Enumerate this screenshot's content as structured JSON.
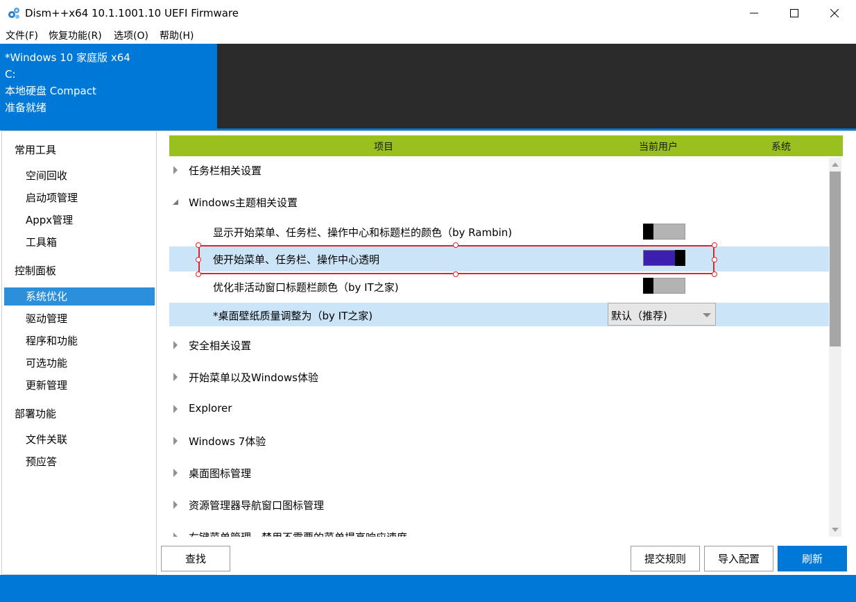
{
  "window": {
    "title": "Dism++x64 10.1.1001.10 UEFI Firmware",
    "icon": "gear-cluster-icon"
  },
  "menu": [
    "文件(F)",
    "恢复功能(R)",
    "选项(O)",
    "帮助(H)"
  ],
  "image_info": {
    "name": "*Windows 10 家庭版 x64",
    "drive": "C:",
    "disk": "本地硬盘 Compact",
    "status": "准备就绪"
  },
  "sidebar": {
    "groups": [
      {
        "label": "常用工具",
        "items": [
          "空间回收",
          "启动项管理",
          "Appx管理",
          "工具箱"
        ]
      },
      {
        "label": "控制面板",
        "items": [
          "系统优化",
          "驱动管理",
          "程序和功能",
          "可选功能",
          "更新管理"
        ]
      },
      {
        "label": "部署功能",
        "items": [
          "文件关联",
          "预应答"
        ]
      }
    ],
    "active_item": "系统优化"
  },
  "columns": {
    "item": "项目",
    "current_user": "当前用户",
    "system": "系统"
  },
  "list": {
    "rows": [
      {
        "label": "任务栏相关设置",
        "type": "group",
        "expanded": false
      },
      {
        "label": "Windows主题相关设置",
        "type": "group",
        "expanded": true
      },
      {
        "label": "显示开始菜单、任务栏、操作中心和标题栏的颜色（by Rambin)",
        "type": "toggle",
        "state": "off"
      },
      {
        "label": "使开始菜单、任务栏、操作中心透明",
        "type": "toggle",
        "state": "on"
      },
      {
        "label": "优化非活动窗口标题栏颜色（by IT之家)",
        "type": "toggle",
        "state": "off"
      },
      {
        "label": "*桌面壁纸质量调整为（by IT之家)",
        "type": "dropdown",
        "value": "默认（推荐)"
      },
      {
        "label": "安全相关设置",
        "type": "group",
        "expanded": false
      },
      {
        "label": "开始菜单以及Windows体验",
        "type": "group",
        "expanded": false
      },
      {
        "label": "Explorer",
        "type": "group",
        "expanded": false
      },
      {
        "label": "Windows 7体验",
        "type": "group",
        "expanded": false
      },
      {
        "label": "桌面图标管理",
        "type": "group",
        "expanded": false
      },
      {
        "label": "资源管理器导航窗口图标管理",
        "type": "group",
        "expanded": false
      },
      {
        "label": "右键菜单管理 - 禁用不需要的菜单提高响应速度",
        "type": "group",
        "expanded": false
      }
    ]
  },
  "buttons": {
    "find": "查找",
    "submit_rules": "提交规则",
    "import_config": "导入配置",
    "refresh": "刷新"
  },
  "colors": {
    "accent": "#0078d7",
    "header_green": "#99c01c",
    "toggle_on": "#3d1fb0",
    "selection_highlight": "#e02424"
  }
}
